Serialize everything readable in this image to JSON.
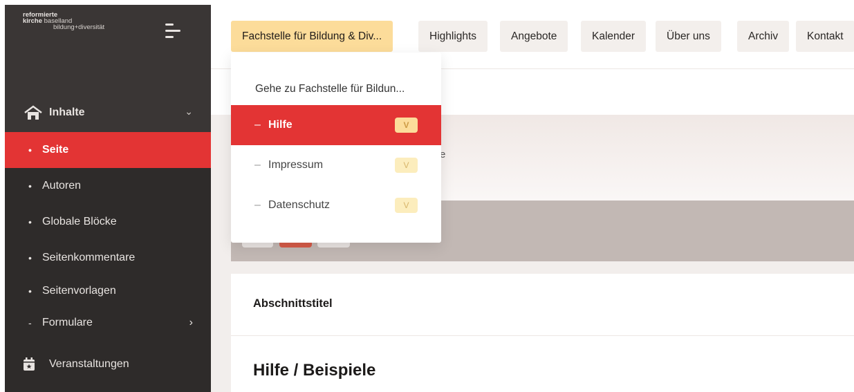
{
  "logo": {
    "line1": "reformierte",
    "line2a": "kirche",
    "line2b": " baselland",
    "line3": "bildung+diversität"
  },
  "sidebar": {
    "section": "Inhalte",
    "items": [
      {
        "label": "Seite",
        "bullet": "•"
      },
      {
        "label": "Autoren",
        "bullet": "•"
      },
      {
        "label": "Globale Blöcke",
        "bullet": "•"
      },
      {
        "label": "Seitenkommentare",
        "bullet": "•"
      },
      {
        "label": "Seitenvorlagen",
        "bullet": "•"
      },
      {
        "label": "Formulare",
        "bullet": "-",
        "arrow": "›"
      }
    ],
    "events": "Veranstaltungen",
    "chevron": "⌄"
  },
  "tabs": [
    {
      "label": "Fachstelle für Bildung & Div..."
    },
    {
      "label": "Highlights"
    },
    {
      "label": "Angebote"
    },
    {
      "label": "Kalender"
    },
    {
      "label": "Über uns"
    },
    {
      "label": "Archiv"
    },
    {
      "label": "Kontakt"
    }
  ],
  "dropdown": {
    "goto": "Gehe zu Fachstelle für Bildun...",
    "items": [
      {
        "label": "Hilfe",
        "dash": "–",
        "badge": "V"
      },
      {
        "label": "Impressum",
        "dash": "–",
        "badge": "V"
      },
      {
        "label": "Datenschutz",
        "dash": "–",
        "badge": "V"
      }
    ]
  },
  "content": {
    "fragment": "e",
    "section_title": "Abschnittstitel",
    "heading": "Hilfe / Beispiele"
  },
  "colors": {
    "accent_red": "#e33434",
    "tab_active": "#fcdc9a",
    "sidebar_bg": "#2e2b2a"
  }
}
